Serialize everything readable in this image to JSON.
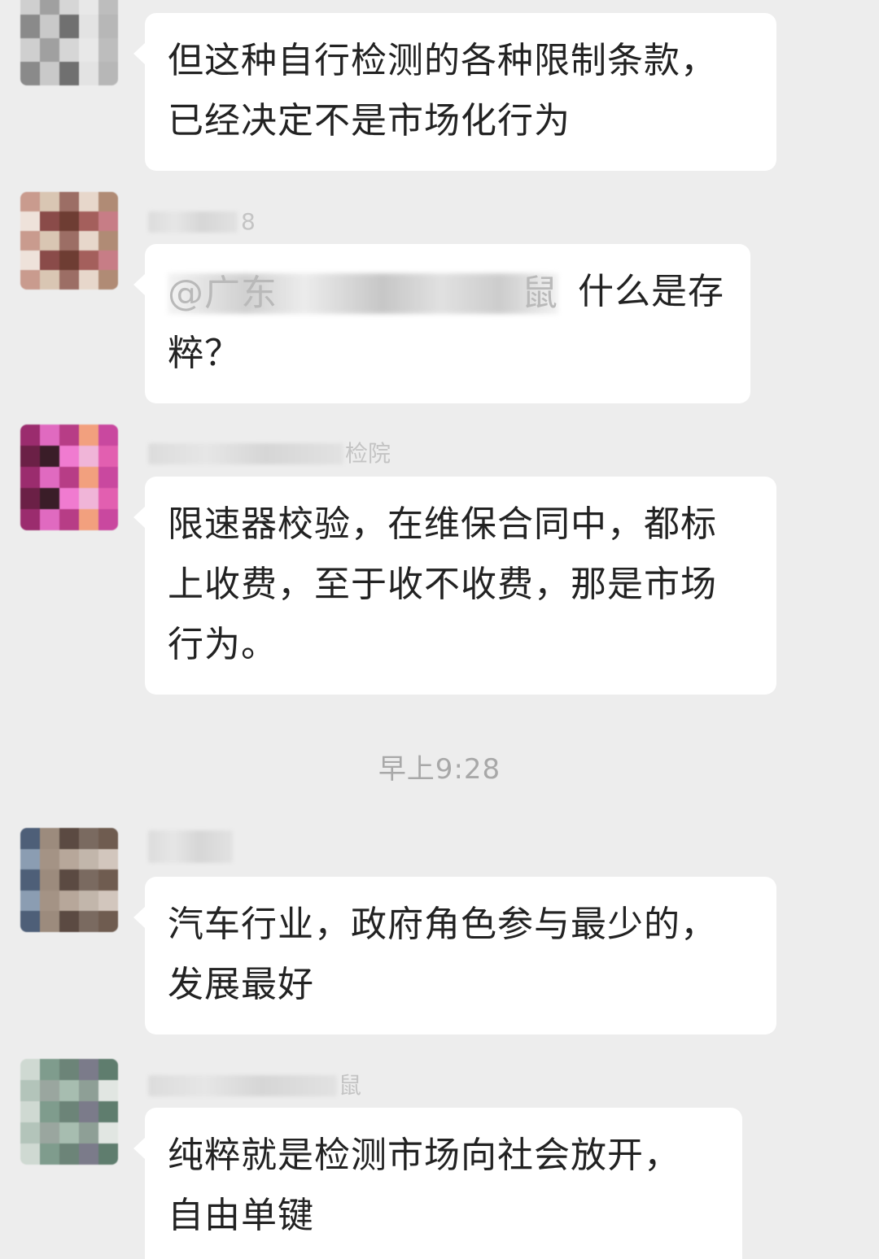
{
  "messages": [
    {
      "sender": "",
      "text_lines": [
        "但这种自行检测的各种限制条款，",
        "已经决定不是市场化行为"
      ]
    },
    {
      "sender": "8",
      "mention": "@广东",
      "mention_tail": "鼠",
      "text_lines": [
        "什么是存",
        "粹？"
      ]
    },
    {
      "sender": "检院",
      "text_lines": [
        "限速器校验，在维保合同中，都标",
        "上收费，至于收不收费，那是市场",
        "行为。"
      ]
    },
    {
      "sender": "",
      "text_lines": [
        "汽车行业，政府角色参与最少的，",
        "发展最好"
      ]
    },
    {
      "sender": "鼠",
      "text_lines": [
        "纯粹就是检测市场向社会放开，",
        "自由单键"
      ]
    }
  ],
  "timestamp": "早上9:28",
  "colors": {
    "background": "#ededed",
    "bubble": "#ffffff",
    "text": "#222222",
    "meta": "#a8a8a8"
  }
}
